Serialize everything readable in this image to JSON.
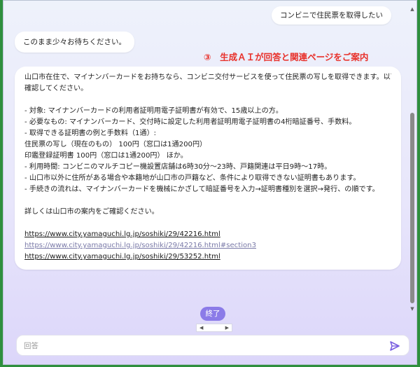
{
  "conversation": {
    "user_message": "コンビニで住民票を取得したい",
    "bot_wait_message": "このまま少々お待ちください。",
    "annotation": "③　生成ＡＩが回答と関連ページをご案内",
    "answer": {
      "lines": [
        "山口市在住で、マイナンバーカードをお持ちなら、コンビニ交付サービスを使って住民票の写しを取得できます。以下を",
        "確認してください。",
        "",
        "- 対象: マイナンバーカードの利用者証明用電子証明書が有効で、15歳以上の方。",
        "- 必要なもの: マイナンバーカード、交付時に設定した利用者証明用電子証明書の4桁暗証番号、手数料。",
        "- 取得できる証明書の例と手数料（1通）:",
        "  住民票の写し（現在のもの） 100円（窓口は1通200円）",
        "  印鑑登録証明書 100円（窓口は1通200円） ほか。",
        "- 利用時間: コンビニのマルチコピー機設置店舗は6時30分～23時、戸籍関連は平日9時～17時。",
        "- 山口市以外に住所がある場合や本籍地が山口市の戸籍など、条件により取得できない証明書もあります。",
        "- 手続きの流れは、マイナンバーカードを機械にかざして暗証番号を入力→証明書種別を選択→発行、の順です。",
        "",
        "詳しくは山口市の案内をご確認ください。",
        ""
      ],
      "links": [
        "https://www.city.yamaguchi.lg.jp/soshiki/29/42216.html",
        "https://www.city.yamaguchi.lg.jp/soshiki/29/42216.html#section3",
        "https://www.city.yamaguchi.lg.jp/soshiki/29/53252.html"
      ]
    }
  },
  "controls": {
    "end_button": "終了",
    "pager_prev": "◀",
    "pager_next": "▶",
    "input_placeholder": "回答",
    "send_icon": "send-icon"
  },
  "colors": {
    "accent": "#8b7be8",
    "annotation": "#e8302a",
    "frame_border": "#2f8f3e"
  }
}
